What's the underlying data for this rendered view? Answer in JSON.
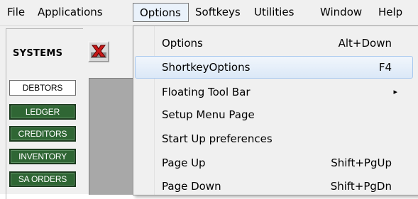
{
  "menubar": {
    "items": [
      "File",
      "Applications",
      "Options",
      "Softkeys",
      "Utilities",
      "Window",
      "Help"
    ],
    "open_item": "Options"
  },
  "systems": {
    "label": "SYSTEMS",
    "buttons": [
      "DEBTORS",
      "LEDGER",
      "CREDITORS",
      "INVENTORY",
      "SA ORDERS"
    ],
    "active": "DEBTORS"
  },
  "toolbar": {
    "icon": "x-close-icon"
  },
  "options_menu": {
    "items": [
      {
        "label": "Options",
        "shortcut": "Alt+Down"
      },
      {
        "label": "ShortkeyOptions",
        "shortcut": "F4"
      },
      {
        "label": "Floating Tool Bar",
        "shortcut": ""
      },
      {
        "label": "Setup Menu Page",
        "shortcut": ""
      },
      {
        "label": "Start Up preferences",
        "shortcut": ""
      },
      {
        "label": "Page Up",
        "shortcut": "Shift+PgUp"
      },
      {
        "label": "Page Down",
        "shortcut": "Shift+PgDn"
      }
    ],
    "highlighted": "ShortkeyOptions",
    "submenu_arrow": "▸"
  },
  "colors": {
    "green_button": "#2f6634",
    "highlight": "#dbe8f7"
  }
}
